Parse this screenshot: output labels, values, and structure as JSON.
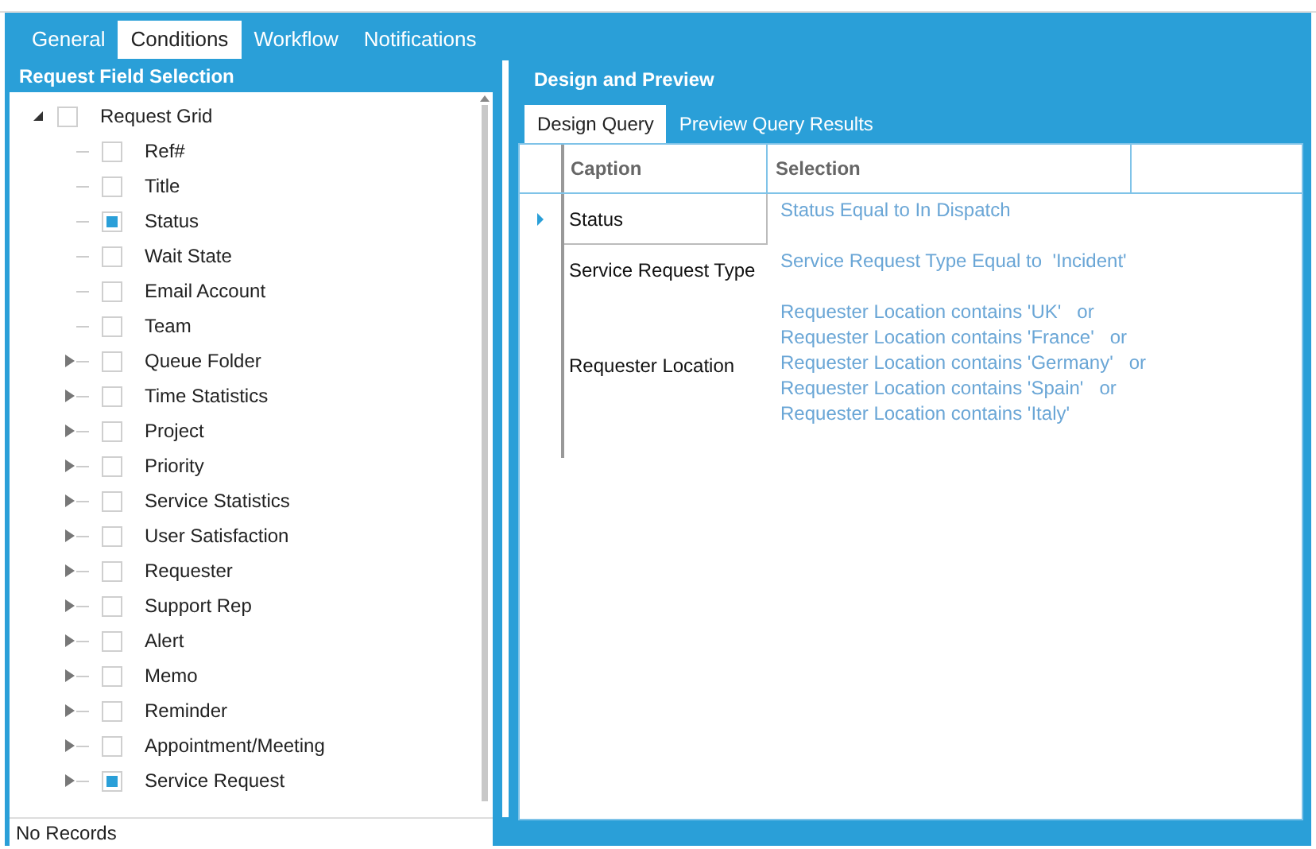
{
  "tabs": [
    {
      "label": "General",
      "selected": false
    },
    {
      "label": "Conditions",
      "selected": true
    },
    {
      "label": "Workflow",
      "selected": false
    },
    {
      "label": "Notifications",
      "selected": false
    }
  ],
  "field_selection": {
    "title": "Request Field Selection",
    "tree": [
      {
        "label": "Request Grid",
        "checked": false,
        "expanded": true,
        "children": [
          {
            "label": "Ref#",
            "kind": "leaf",
            "checked": false
          },
          {
            "label": "Title",
            "kind": "leaf",
            "checked": false
          },
          {
            "label": "Status",
            "kind": "leaf",
            "checked": true
          },
          {
            "label": "Wait State",
            "kind": "leaf",
            "checked": false
          },
          {
            "label": "Email Account",
            "kind": "leaf",
            "checked": false
          },
          {
            "label": "Team",
            "kind": "leaf",
            "checked": false
          },
          {
            "label": "Queue Folder",
            "kind": "group",
            "checked": false
          },
          {
            "label": "Time Statistics",
            "kind": "group",
            "checked": false
          },
          {
            "label": "Project",
            "kind": "group",
            "checked": false
          },
          {
            "label": "Priority",
            "kind": "group",
            "checked": false
          },
          {
            "label": "Service Statistics",
            "kind": "group",
            "checked": false
          },
          {
            "label": "User Satisfaction",
            "kind": "group",
            "checked": false
          },
          {
            "label": "Requester",
            "kind": "group",
            "checked": false
          },
          {
            "label": "Support Rep",
            "kind": "group",
            "checked": false
          },
          {
            "label": "Alert",
            "kind": "group",
            "checked": false
          },
          {
            "label": "Memo",
            "kind": "group",
            "checked": false
          },
          {
            "label": "Reminder",
            "kind": "group",
            "checked": false
          },
          {
            "label": "Appointment/Meeting",
            "kind": "group",
            "checked": false
          },
          {
            "label": "Service Request",
            "kind": "group",
            "checked": true
          }
        ]
      }
    ],
    "status_bar": "No Records"
  },
  "design": {
    "title": "Design and Preview",
    "tabs": [
      {
        "label": "Design Query",
        "selected": true
      },
      {
        "label": "Preview Query Results",
        "selected": false
      }
    ],
    "table": {
      "columns": [
        "Caption",
        "Selection"
      ],
      "rows": [
        {
          "caption": "Status",
          "selected": true,
          "selection": [
            "Status Equal to In Dispatch"
          ]
        },
        {
          "caption": "Service Request Type",
          "selected": false,
          "selection": [
            "Service Request Type Equal to  'Incident'"
          ]
        },
        {
          "caption": "Requester Location",
          "selected": false,
          "selection": [
            "Requester Location contains 'UK'   or",
            "Requester Location contains 'France'   or",
            "Requester Location contains 'Germany'   or",
            "Requester Location contains 'Spain'   or",
            "Requester Location contains 'Italy'"
          ]
        }
      ]
    }
  }
}
